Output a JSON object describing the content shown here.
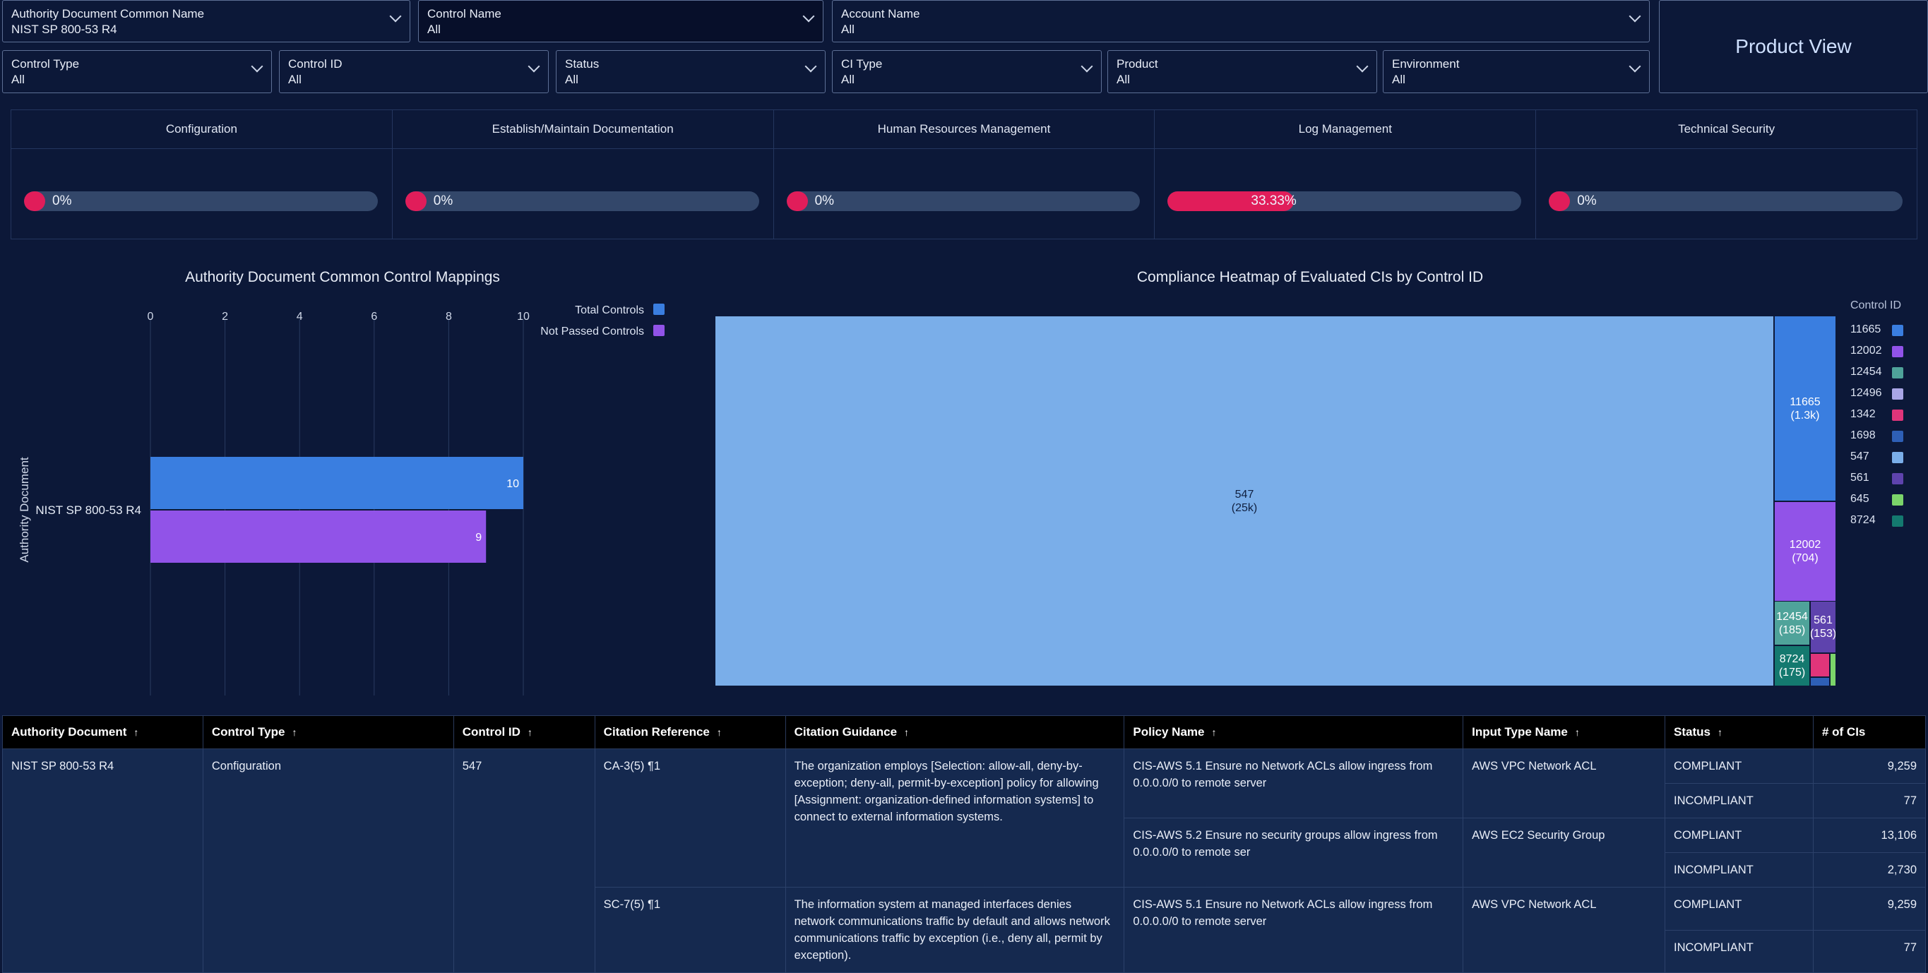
{
  "filters_row1": [
    {
      "label": "Authority Document Common Name",
      "value": "NIST SP 800-53 R4"
    },
    {
      "label": "Control Name",
      "value": "All"
    },
    {
      "label": "Account Name",
      "value": "All"
    }
  ],
  "filters_row2": [
    {
      "label": "Control Type",
      "value": "All"
    },
    {
      "label": "Control ID",
      "value": "All"
    },
    {
      "label": "Status",
      "value": "All"
    },
    {
      "label": "CI Type",
      "value": "All"
    },
    {
      "label": "Product",
      "value": "All"
    },
    {
      "label": "Environment",
      "value": "All"
    }
  ],
  "product_view_label": "Product View",
  "categories": [
    {
      "title": "Configuration",
      "percent_label": "0%",
      "percent": 0
    },
    {
      "title": "Establish/Maintain Documentation",
      "percent_label": "0%",
      "percent": 0
    },
    {
      "title": "Human Resources Management",
      "percent_label": "0%",
      "percent": 0
    },
    {
      "title": "Log Management",
      "percent_label": "33.33%",
      "percent": 33.33
    },
    {
      "title": "Technical Security",
      "percent_label": "0%",
      "percent": 0
    }
  ],
  "chart_data": [
    {
      "type": "bar",
      "title": "Authority Document Common Control Mappings",
      "ylabel": "Authority Document",
      "categories": [
        "NIST SP 800-53 R4"
      ],
      "x_ticks": [
        "0",
        "2",
        "4",
        "6",
        "8",
        "10"
      ],
      "xlim": [
        0,
        10
      ],
      "series": [
        {
          "name": "Total Controls",
          "values": [
            10
          ],
          "labels": [
            "10"
          ],
          "color": "#3a7ee0"
        },
        {
          "name": "Not Passed Controls",
          "values": [
            9
          ],
          "labels": [
            "9"
          ],
          "color": "#9153e8"
        }
      ],
      "legend_position": "top-right"
    },
    {
      "type": "heatmap",
      "title": "Compliance Heatmap of Evaluated CIs by Control ID",
      "legend_title": "Control ID",
      "cells": [
        {
          "id": "547",
          "value": 25000,
          "label": "(25k)",
          "color": "#7aaee9"
        },
        {
          "id": "11665",
          "value": 1300,
          "label": "(1.3k)",
          "color": "#3a7ee0"
        },
        {
          "id": "12002",
          "value": 704,
          "label": "(704)",
          "color": "#9153e8"
        },
        {
          "id": "12454",
          "value": 185,
          "label": "(185)",
          "color": "#4fa39a"
        },
        {
          "id": "561",
          "value": 153,
          "label": "(153)",
          "color": "#5e43ad"
        },
        {
          "id": "8724",
          "value": 175,
          "label": "(175)",
          "color": "#14796f"
        },
        {
          "id": "1342",
          "value": 60,
          "label": "",
          "color": "#e0357a"
        },
        {
          "id": "645",
          "value": 30,
          "label": "",
          "color": "#7bd46a"
        },
        {
          "id": "1698",
          "value": 25,
          "label": "",
          "color": "#2e5fb6"
        }
      ],
      "legend": [
        {
          "id": "11665",
          "color": "#3a7ee0"
        },
        {
          "id": "12002",
          "color": "#9153e8"
        },
        {
          "id": "12454",
          "color": "#4fa39a"
        },
        {
          "id": "12496",
          "color": "#a9a6e6"
        },
        {
          "id": "1342",
          "color": "#e0357a"
        },
        {
          "id": "1698",
          "color": "#2e5fb6"
        },
        {
          "id": "547",
          "color": "#7aaee9"
        },
        {
          "id": "561",
          "color": "#5e43ad"
        },
        {
          "id": "645",
          "color": "#7bd46a"
        },
        {
          "id": "8724",
          "color": "#14796f"
        }
      ]
    }
  ],
  "table": {
    "columns": [
      "Authority Document",
      "Control Type",
      "Control ID",
      "Citation Reference",
      "Citation Guidance",
      "Policy Name",
      "Input Type Name",
      "Status",
      "# of CIs"
    ],
    "authority_document": "NIST SP 800-53 R4",
    "control_type": "Configuration",
    "control_id": "547",
    "citations": [
      {
        "reference": "CA-3(5) ¶1",
        "guidance": "The organization employs [Selection: allow-all, deny-by-exception; deny-all, permit-by-exception] policy for allowing [Assignment: organization-defined information systems] to connect to external information systems.",
        "policies": [
          {
            "name": "CIS-AWS 5.1 Ensure no Network ACLs allow ingress from 0.0.0.0/0 to remote server",
            "input_type": "AWS VPC Network ACL",
            "rows": [
              {
                "status": "COMPLIANT",
                "count": "9,259"
              },
              {
                "status": "INCOMPLIANT",
                "count": "77"
              }
            ]
          },
          {
            "name": "CIS-AWS 5.2 Ensure no security groups allow ingress from 0.0.0.0/0 to remote ser",
            "input_type": "AWS EC2 Security Group",
            "rows": [
              {
                "status": "COMPLIANT",
                "count": "13,106"
              },
              {
                "status": "INCOMPLIANT",
                "count": "2,730"
              }
            ]
          }
        ]
      },
      {
        "reference": "SC-7(5) ¶1",
        "guidance": "The information system at managed interfaces denies network communications traffic by default and allows network communications traffic by exception (i.e., deny all, permit by exception).",
        "policies": [
          {
            "name": "CIS-AWS 5.1 Ensure no Network ACLs allow ingress from 0.0.0.0/0 to remote server",
            "input_type": "AWS VPC Network ACL",
            "rows": [
              {
                "status": "COMPLIANT",
                "count": "9,259"
              },
              {
                "status": "INCOMPLIANT",
                "count": "77"
              }
            ]
          }
        ]
      }
    ]
  }
}
